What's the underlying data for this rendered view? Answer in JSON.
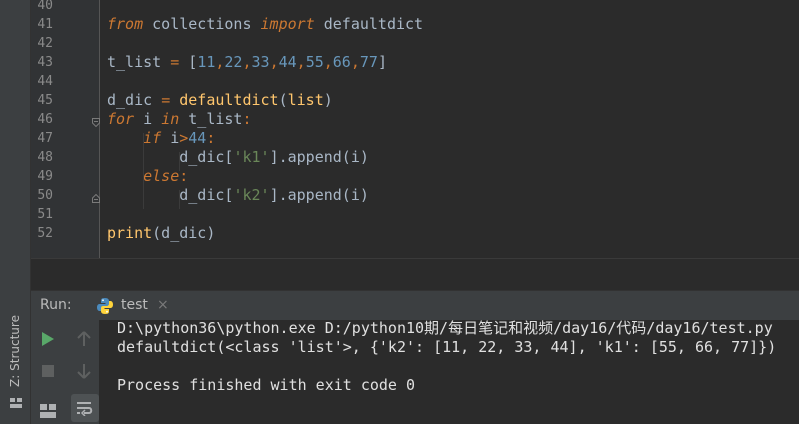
{
  "editor": {
    "lines": [
      {
        "n": "40",
        "tokens": []
      },
      {
        "n": "41",
        "tokens": [
          {
            "c": "kw",
            "t": "from"
          },
          {
            "c": "pl",
            "t": " collections "
          },
          {
            "c": "kw",
            "t": "import"
          },
          {
            "c": "pl",
            "t": " defaultdict"
          }
        ]
      },
      {
        "n": "42",
        "tokens": []
      },
      {
        "n": "43",
        "tokens": [
          {
            "c": "pl",
            "t": "t_list "
          },
          {
            "c": "op",
            "t": "="
          },
          {
            "c": "pl",
            "t": " ["
          },
          {
            "c": "num",
            "t": "11"
          },
          {
            "c": "op",
            "t": ","
          },
          {
            "c": "num",
            "t": "22"
          },
          {
            "c": "op",
            "t": ","
          },
          {
            "c": "num",
            "t": "33"
          },
          {
            "c": "op",
            "t": ","
          },
          {
            "c": "num",
            "t": "44"
          },
          {
            "c": "op",
            "t": ","
          },
          {
            "c": "num",
            "t": "55"
          },
          {
            "c": "op",
            "t": ","
          },
          {
            "c": "num",
            "t": "66"
          },
          {
            "c": "op",
            "t": ","
          },
          {
            "c": "num",
            "t": "77"
          },
          {
            "c": "pl",
            "t": "]"
          }
        ]
      },
      {
        "n": "44",
        "tokens": []
      },
      {
        "n": "45",
        "tokens": [
          {
            "c": "pl",
            "t": "d_dic "
          },
          {
            "c": "op",
            "t": "="
          },
          {
            "c": "pl",
            "t": " "
          },
          {
            "c": "fn",
            "t": "defaultdict"
          },
          {
            "c": "pl",
            "t": "("
          },
          {
            "c": "fn",
            "t": "list"
          },
          {
            "c": "pl",
            "t": ")"
          }
        ]
      },
      {
        "n": "46",
        "tokens": [
          {
            "c": "kw",
            "t": "for"
          },
          {
            "c": "pl",
            "t": " i "
          },
          {
            "c": "kw",
            "t": "in"
          },
          {
            "c": "pl",
            "t": " t_list"
          },
          {
            "c": "op",
            "t": ":"
          }
        ]
      },
      {
        "n": "47",
        "tokens": [
          {
            "c": "pl",
            "t": "    "
          },
          {
            "c": "kw",
            "t": "if"
          },
          {
            "c": "pl",
            "t": " i"
          },
          {
            "c": "op",
            "t": ">"
          },
          {
            "c": "num",
            "t": "44"
          },
          {
            "c": "op",
            "t": ":"
          }
        ]
      },
      {
        "n": "48",
        "tokens": [
          {
            "c": "pl",
            "t": "        d_dic["
          },
          {
            "c": "str",
            "t": "'k1'"
          },
          {
            "c": "pl",
            "t": "].append(i)"
          }
        ]
      },
      {
        "n": "49",
        "tokens": [
          {
            "c": "pl",
            "t": "    "
          },
          {
            "c": "kw",
            "t": "else"
          },
          {
            "c": "op",
            "t": ":"
          }
        ]
      },
      {
        "n": "50",
        "tokens": [
          {
            "c": "pl",
            "t": "        d_dic["
          },
          {
            "c": "str",
            "t": "'k2'"
          },
          {
            "c": "pl",
            "t": "].append(i)"
          }
        ]
      },
      {
        "n": "51",
        "tokens": []
      },
      {
        "n": "52",
        "tokens": [
          {
            "c": "fn",
            "t": "print"
          },
          {
            "c": "pl",
            "t": "(d_dic)"
          }
        ]
      }
    ]
  },
  "run_panel": {
    "label": "Run:",
    "tab_label": "test",
    "tab_close": "×",
    "console_lines": [
      "D:\\python36\\python.exe D:/python10期/每日笔记和视频/day16/代码/day16/test.py",
      "defaultdict(<class 'list'>, {'k2': [11, 22, 33, 44], 'k1': [55, 66, 77]})",
      "",
      "Process finished with exit code 0"
    ]
  },
  "side_strip": {
    "structure_label": "Z: Structure"
  },
  "colors": {
    "background": "#2b2b2b",
    "keyword": "#cc7832",
    "number": "#6897bb",
    "function": "#ffc66d",
    "string": "#6a8759",
    "text": "#a9b7c6",
    "run_green": "#59a869"
  }
}
